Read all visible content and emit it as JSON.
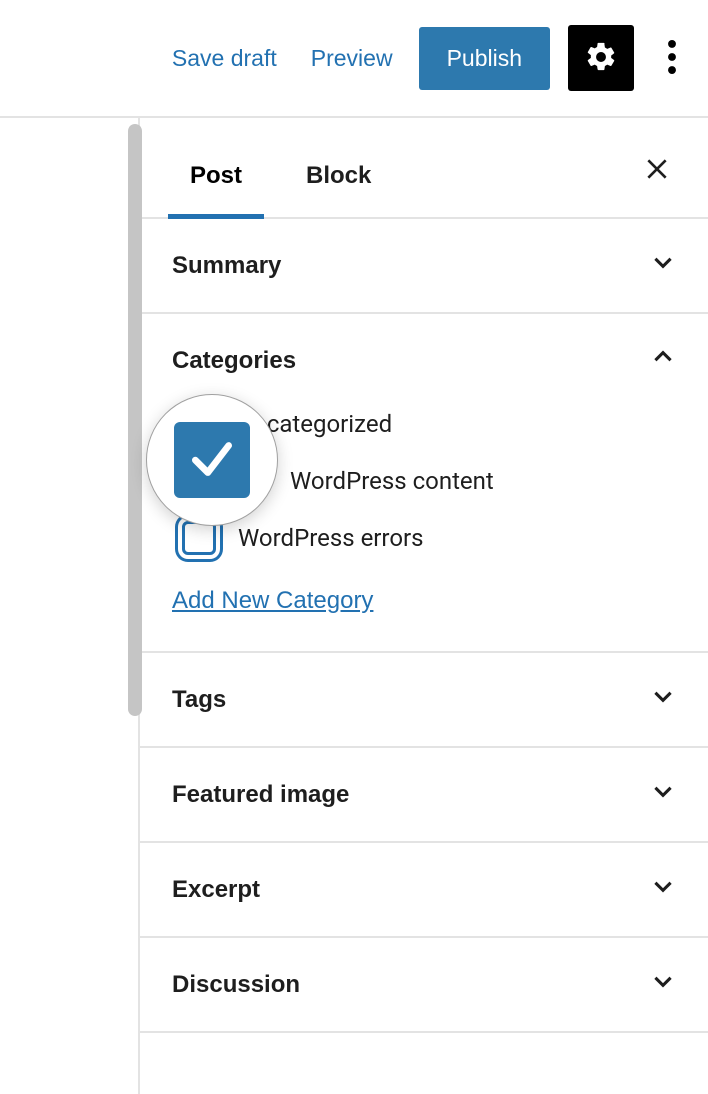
{
  "toolbar": {
    "save_draft": "Save draft",
    "preview": "Preview",
    "publish": "Publish"
  },
  "tabs": {
    "post": "Post",
    "block": "Block",
    "active": "post"
  },
  "panels": {
    "summary": {
      "title": "Summary",
      "expanded": false
    },
    "categories": {
      "title": "Categories",
      "expanded": true
    },
    "tags": {
      "title": "Tags",
      "expanded": false
    },
    "featured_image": {
      "title": "Featured image",
      "expanded": false
    },
    "excerpt": {
      "title": "Excerpt",
      "expanded": false
    },
    "discussion": {
      "title": "Discussion",
      "expanded": false
    }
  },
  "categories": {
    "items": [
      {
        "label": "Uncategorized",
        "checked": false,
        "focused": false
      },
      {
        "label": "WordPress content",
        "checked": true,
        "focused": false
      },
      {
        "label": "WordPress errors",
        "checked": false,
        "focused": true
      }
    ],
    "add_new_label": "Add New Category"
  }
}
